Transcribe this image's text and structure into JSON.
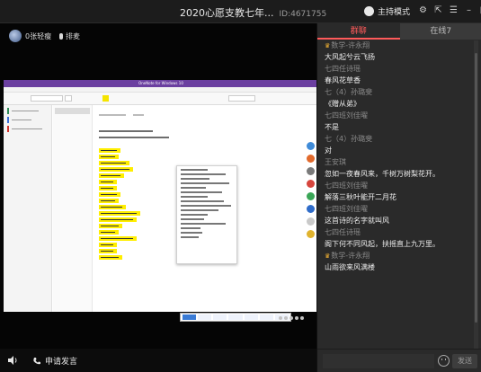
{
  "window": {
    "title": "2020心愿支教七年...",
    "room_id": "ID:4671755",
    "host_mode_label": "主持模式"
  },
  "stage": {
    "presenter_name": "0张轻瘦",
    "mic_queue_label": "排麦",
    "shared_app_title": "OneNote for Windows 10"
  },
  "bottombar": {
    "apply_label": "申请发言"
  },
  "chat": {
    "tabs": [
      {
        "label": "群聊",
        "active": true
      },
      {
        "label": "在线7",
        "active": false
      }
    ],
    "messages": [
      {
        "from": "数学-许永翔",
        "host": true,
        "text": "大风起兮云飞扬"
      },
      {
        "from": "七四任诗瑶",
        "host": false,
        "text": "春风花草香"
      },
      {
        "from": "七（4）孙璐斐",
        "host": false,
        "text": "《赠从弟》"
      },
      {
        "from": "七四班刘佳曜",
        "host": false,
        "text": "不是"
      },
      {
        "from": "七（4）孙璐斐",
        "host": false,
        "text": "对"
      },
      {
        "from": "王安琪",
        "host": false,
        "text": "忽如一夜春风来，千树万树梨花开。"
      },
      {
        "from": "七四班刘佳曜",
        "host": false,
        "text": "解落三秋叶能开二月花"
      },
      {
        "from": "七四班刘佳曜",
        "host": false,
        "text": "这首诗的名字就叫风"
      },
      {
        "from": "七四任诗瑶",
        "host": false,
        "text": "阁下何不同风起，扶摇直上九万里。"
      },
      {
        "from": "数学-许永翔",
        "host": true,
        "text": "山雨欲来风满楼"
      }
    ],
    "input_placeholder": "",
    "send_label": "发送"
  },
  "colors": {
    "accent": "#ff5a5a",
    "onenote_purple": "#6b3fa0",
    "highlight_yellow": "#ffee00"
  }
}
